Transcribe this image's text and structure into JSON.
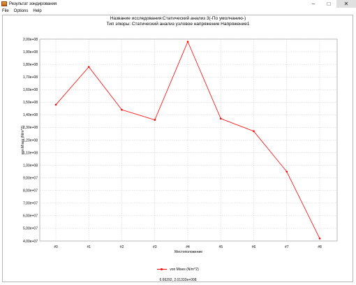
{
  "window": {
    "title": "Результат зондирования",
    "controls": {
      "minimize": "–",
      "maximize": "□",
      "close": "✕"
    },
    "icon": "app-icon"
  },
  "menu": {
    "items": [
      "File",
      "Options",
      "Help"
    ]
  },
  "chart_data": {
    "type": "line",
    "title": "Название исследования:Статический анализ 3(-По умолчанию-)",
    "subtitle": "Тип эпюры: Статический анализ узловое напряжение Напряжение1",
    "xlabel": "Местоположение",
    "ylabel": "von Mises (N/m^2)",
    "categories": [
      "#0",
      "#1",
      "#2",
      "#3",
      "#4",
      "#5",
      "#6",
      "#7",
      "#8"
    ],
    "series": [
      {
        "name": "von Mises (N/m^2)",
        "color": "#ff0000",
        "values": [
          148000000,
          178000000,
          144000000,
          136000000,
          198000000,
          137000000,
          127000000,
          95000000,
          42000000
        ]
      }
    ],
    "ylim": [
      40000000,
      200000000
    ],
    "yticks": [
      "4,00e+07",
      "5,00e+07",
      "6,00e+07",
      "7,00e+07",
      "8,00e+07",
      "9,00e+07",
      "1,00e+08",
      "1,10e+08",
      "1,20e+08",
      "1,30e+08",
      "1,40e+08",
      "1,50e+08",
      "1,60e+08",
      "1,70e+08",
      "1,80e+08",
      "1,90e+08",
      "2,00e+08"
    ],
    "grid": true,
    "legend": "bottom"
  },
  "status": {
    "cursor_readout": "6.66292, 2.01333e+008"
  }
}
